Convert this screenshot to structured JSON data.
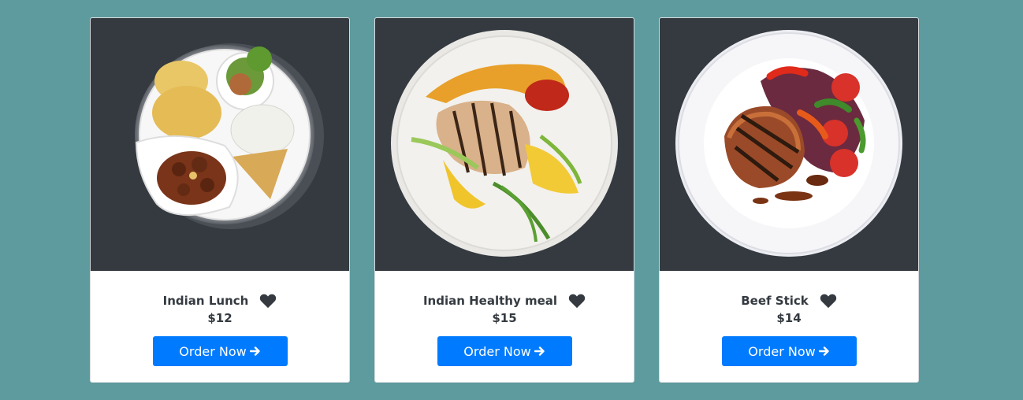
{
  "colors": {
    "background": "#5e9b9e",
    "image_background": "#343a40",
    "button": "#007bff",
    "text": "#343a40"
  },
  "cards": [
    {
      "image": "indian-lunch-plate",
      "title": "Indian Lunch",
      "price": "$12",
      "button_label": "Order Now",
      "heart_icon": "heart-icon",
      "arrow_icon": "arrow-right-icon"
    },
    {
      "image": "indian-healthy-meal-plate",
      "title": "Indian Healthy meal",
      "price": "$15",
      "button_label": "Order Now",
      "heart_icon": "heart-icon",
      "arrow_icon": "arrow-right-icon"
    },
    {
      "image": "beef-stick-plate",
      "title": "Beef Stick",
      "price": "$14",
      "button_label": "Order Now",
      "heart_icon": "heart-icon",
      "arrow_icon": "arrow-right-icon"
    }
  ]
}
